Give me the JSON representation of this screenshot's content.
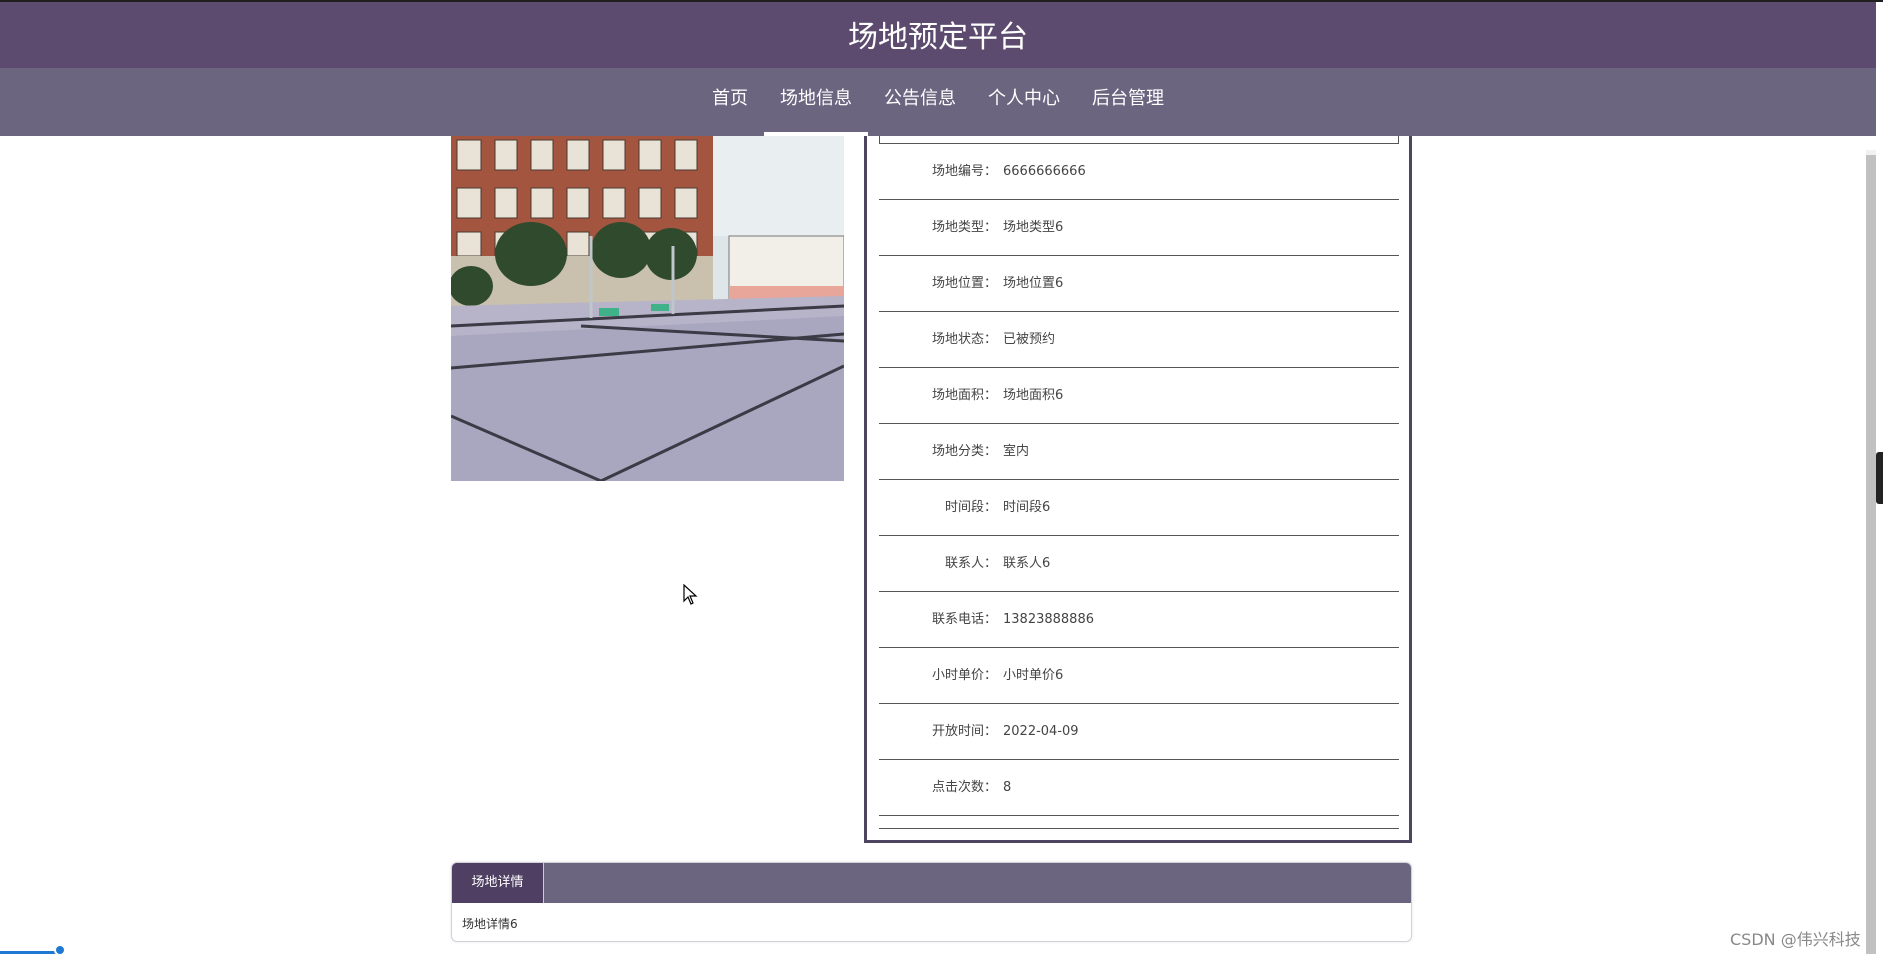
{
  "header": {
    "site_title": "场地预定平台"
  },
  "nav": {
    "items": [
      {
        "label": "首页"
      },
      {
        "label": "场地信息",
        "active": true
      },
      {
        "label": "公告信息"
      },
      {
        "label": "个人中心"
      },
      {
        "label": "后台管理"
      }
    ]
  },
  "venue": {
    "fields": [
      {
        "label": "场地编号：",
        "value": "6666666666"
      },
      {
        "label": "场地类型：",
        "value": "场地类型6"
      },
      {
        "label": "场地位置：",
        "value": "场地位置6"
      },
      {
        "label": "场地状态：",
        "value": "已被预约"
      },
      {
        "label": "场地面积：",
        "value": "场地面积6"
      },
      {
        "label": "场地分类：",
        "value": "室内"
      },
      {
        "label": "时间段：",
        "value": "时间段6"
      },
      {
        "label": "联系人：",
        "value": "联系人6"
      },
      {
        "label": "联系电话：",
        "value": "13823888886"
      },
      {
        "label": "小时单价：",
        "value": "小时单价6"
      },
      {
        "label": "开放时间：",
        "value": "2022-04-09"
      },
      {
        "label": "点击次数：",
        "value": "8"
      }
    ]
  },
  "details": {
    "tab_label": "场地详情",
    "content": "场地详情6"
  },
  "watermark": "CSDN @伟兴科技",
  "colors": {
    "header_bg": "#5c4b6f",
    "nav_bg": "#6b6580",
    "panel_border": "#4e4660",
    "tab_active_bg": "#4e3f63"
  }
}
